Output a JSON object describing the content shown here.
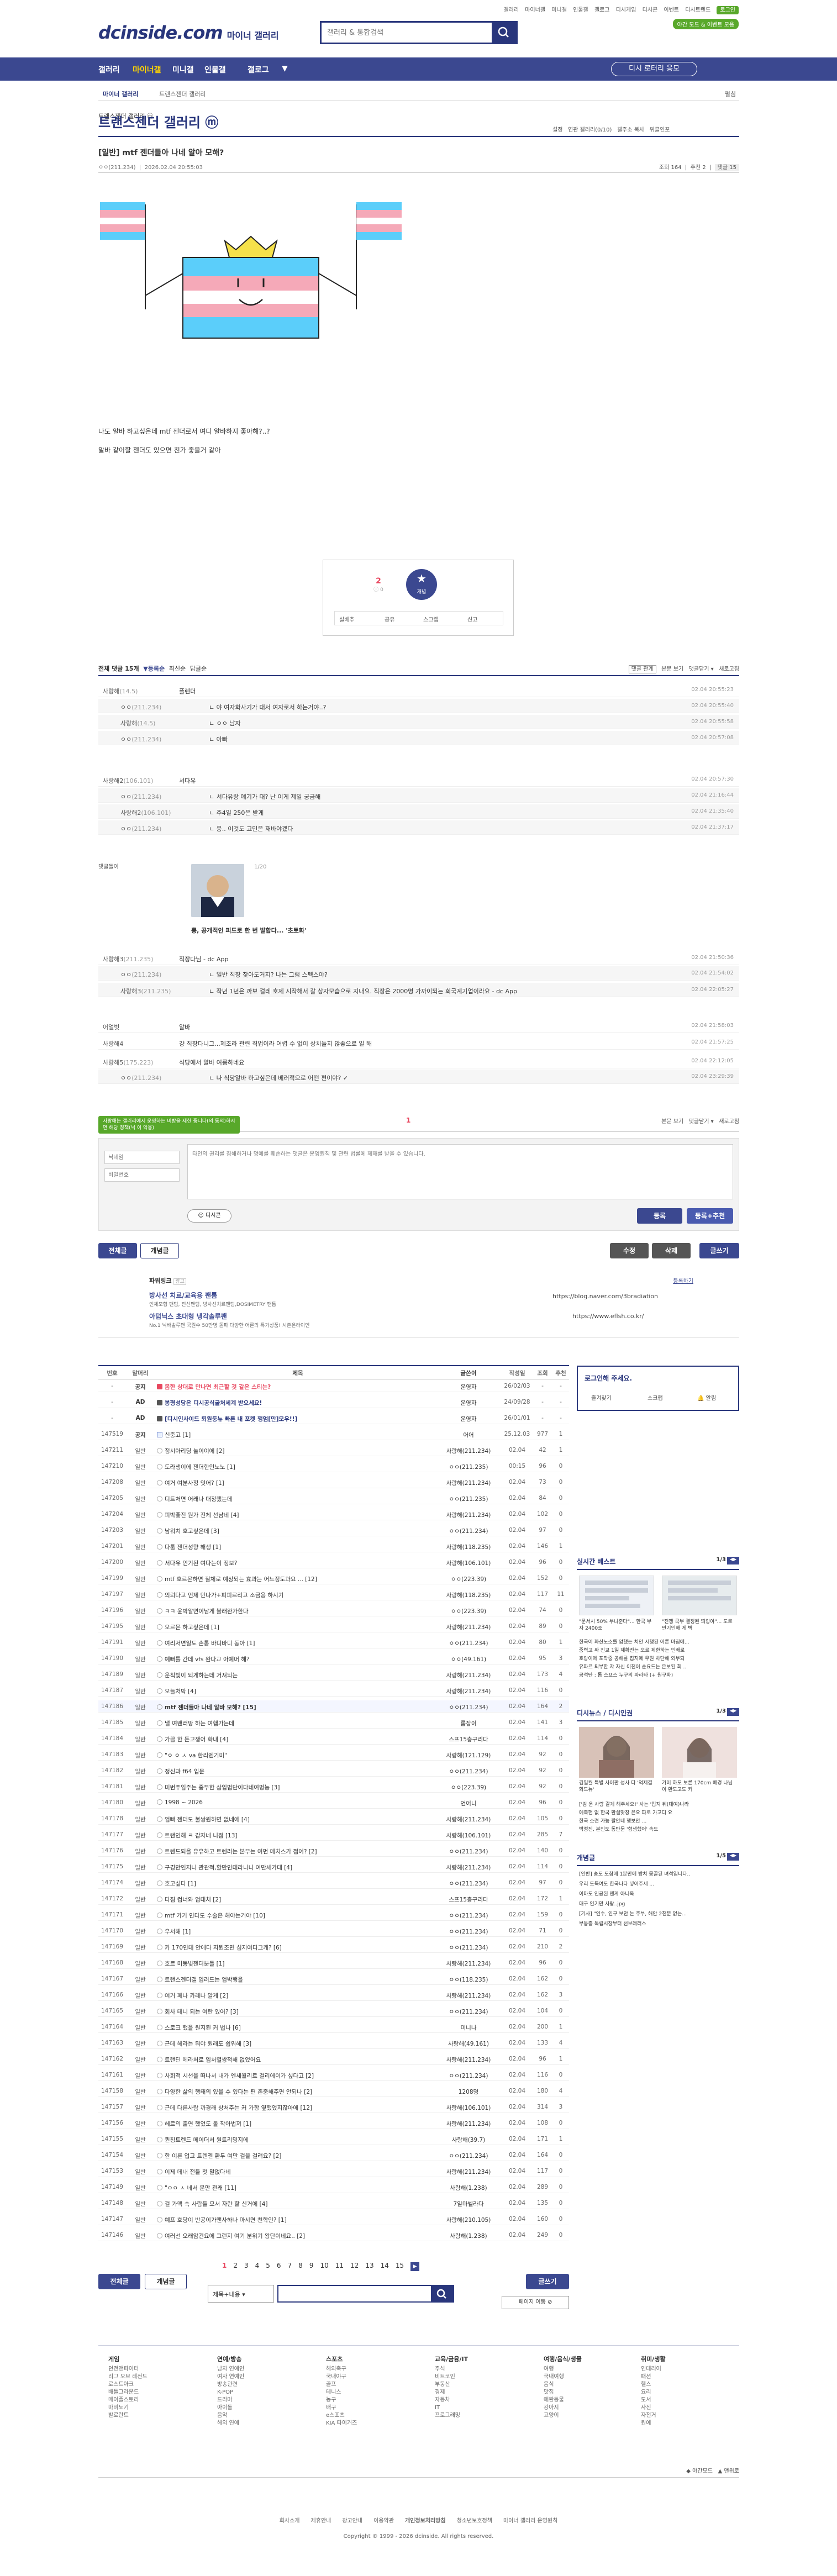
{
  "util": {
    "items": [
      "갤러리",
      "마이너갤",
      "미니갤",
      "인물갤",
      "갤로그",
      "디시게임",
      "디시콘",
      "이벤트",
      "디시트렌드"
    ],
    "login_badge": "로그인",
    "pc_badge": "야간 모드 & 이벤트 모음"
  },
  "header": {
    "logo": "dcinside.com",
    "logo_sub": "마이너 갤러리",
    "search_placeholder": "갤러리 & 통합검색"
  },
  "nav": {
    "items": [
      "갤러리",
      "마이너갤",
      "미니갤",
      "인물갤",
      "갤로그"
    ],
    "more": "▼",
    "right_button": "디시 로터리 응모"
  },
  "breadcrumb": {
    "home": "마이너 갤러리",
    "current": "트랜스젠더 갤러리",
    "toggle": "펼침"
  },
  "gallery": {
    "title": "트랜스젠더 갤러리 ⓜ",
    "tools": [
      "설정",
      "연관 갤러리(0/10)",
      "갤주소 복사",
      "위클인포"
    ]
  },
  "post": {
    "header_label": "[일반] mtf 젠더들아 나네 알아 모해?",
    "nick": "ㅇㅇ(211.234)",
    "date": "2026.02.04 20:55:03",
    "views": "조회 164",
    "rec": "추천 2",
    "cmt": "댓글 15",
    "body_lines": [
      "나도 알바 하고싶은데 mtf 젠더로서 여디 알바하지 좋아해?..?",
      "알바 같이할 젠더도 있으면 친가 좋을거 같아"
    ],
    "rec_up": "2",
    "rec_up_sub": "ⓘ 0",
    "rec_down_label": "개념",
    "actions": [
      "실베추",
      "공유",
      "스크랩",
      "신고"
    ]
  },
  "comments": {
    "header_title": "전체 댓글 15개",
    "sort": [
      "▼등록순",
      "최신순",
      "답글순"
    ],
    "right": [
      "댓글 관계",
      "본문 보기",
      "댓글닫기 ▾",
      "새로고침"
    ],
    "list": [
      {
        "nick": "사랑해",
        "ip": "(14.5)",
        "text": "플렌더",
        "date": "02.04 20:55:23",
        "reply": false
      },
      {
        "nick": "ㅇㅇ",
        "ip": "(211.234)",
        "text": "ㄴ 야 여자화사기가 대서 여자로서 하는거야..?",
        "date": "02.04 20:55:40",
        "reply": true
      },
      {
        "nick": "사랑해",
        "ip": "(14.5)",
        "text": "ㄴ ㅇㅇ 남자",
        "date": "02.04 20:55:58",
        "reply": true
      },
      {
        "nick": "ㅇㅇ",
        "ip": "(211.234)",
        "text": "ㄴ 아빠",
        "date": "02.04 20:57:08",
        "reply": true
      },
      {
        "nick": "사랑해2",
        "ip": "(106.101)",
        "text": "서다유",
        "date": "02.04 20:57:30",
        "reply": false
      },
      {
        "nick": "ㅇㅇ",
        "ip": "(211.234)",
        "text": "ㄴ 서다유랑 얘기가 대? 난 이게 제일 궁금해",
        "date": "02.04 21:16:44",
        "reply": true
      },
      {
        "nick": "사랑해2",
        "ip": "(106.101)",
        "text": "ㄴ 주4일 250은 받게",
        "date": "02.04 21:35:40",
        "reply": true
      },
      {
        "nick": "ㅇㅇ",
        "ip": "(211.234)",
        "text": "ㄴ 응.. 이것도 고민은 재바야겠다",
        "date": "02.04 21:37:17",
        "reply": true
      },
      {
        "nick": "사랑해3",
        "ip": "(211.235)",
        "text": "직장다님 - dc App",
        "date": "02.04 21:50:36",
        "reply": false
      },
      {
        "nick": "ㅇㅇ",
        "ip": "(211.234)",
        "text": "ㄴ 일반 직장 찾아도거지? 나는 그럼 스펙스야?",
        "date": "02.04 21:54:02",
        "reply": true
      },
      {
        "nick": "사랑해3",
        "ip": "(211.235)",
        "text": "ㄴ 작년 1년은 까보 걸레 호제 시작해서 갈 상자모습으로 지내요. 직장은 2000명 가까이되는 회국계기업이라요 - dc App",
        "date": "02.04 22:05:27",
        "reply": true
      },
      {
        "nick": "어얼벗",
        "ip": "",
        "text": "알바",
        "date": "02.04 21:58:03",
        "reply": false
      },
      {
        "nick": "사랑해4",
        "ip": "",
        "text": "걍 직장다니그...제조라 관련 직업이라 어렵 수 없이 상치들지 않좋으로 일 해",
        "date": "02.04 21:57:25",
        "reply": false
      },
      {
        "nick": "사랑해5",
        "ip": "(175.223)",
        "text": "식당에서 알바 여름하네요",
        "date": "02.04 22:12:05",
        "reply": false
      },
      {
        "nick": "ㅇㅇ",
        "ip": "(211.234)",
        "text": "ㄴ 나 식당알바 하고싶은데 베러적으로 어떤 편이야? ✓",
        "date": "02.04 23:29:39",
        "reply": true
      }
    ],
    "dccon_label": "댓글돌이",
    "dccon_caption": "뽕, 공개적인 피드로 한 번 발합다... '초토화'",
    "dccon_page": "1/20",
    "page": "1",
    "bottom_right": [
      "본문 보기",
      "댓글닫기 ▾",
      "새로고침"
    ]
  },
  "write": {
    "tip": "사랑해는 갤러리에서 운영하는 비방을 제한 중니다(의 동의)하시면 해당 정책(닉 이 악용)",
    "nick_placeholder": "닉네임",
    "pw_placeholder": "비밀번호",
    "textarea_placeholder": "타인의 권리를 침해하거나 명예를 훼손하는 댓글은 운영원칙 및 관련 법률에 제재를 받을 수 있습니다.",
    "dccon_button": "디시콘",
    "submit": "등록",
    "submit2": "등록+추천"
  },
  "post_buttons": {
    "all": "전체글",
    "concept": "개념글",
    "modify": "수정",
    "delete": "삭제",
    "write": "글쓰기"
  },
  "ads": [
    {
      "title": "파워링크",
      "badge": "광고",
      "right": "등록하기"
    },
    {
      "title": "방사선 치료/교육용 팬톰",
      "desc": "인체모형 팬텀, 전신팬텀, 방사선치료팬텀,DOSIMETRY 팬톰",
      "url": "https://blog.naver.com/3bradiation"
    },
    {
      "title": "아텀닉스 초대형 냉각솔루팬",
      "desc": "No.1 닉바솔루팬 국원수 50만명 돌파 다양한 어른의 특가상품! 시즌온라이언",
      "url": "https://www.eflsh.co.kr/"
    }
  ],
  "table": {
    "headers": [
      "번호",
      "말머리",
      "제목",
      "글쓴이",
      "작성일",
      "조회",
      "추천"
    ],
    "rows": [
      {
        "no": "-",
        "hd": "공지",
        "t": "몸한 상대로 만나면 최근할 것 같은 스티는?",
        "w": "운영자",
        "d": "26/02/03",
        "v": "-",
        "r": "-",
        "type": "notice"
      },
      {
        "no": "-",
        "hd": "AD",
        "t": "봉평성당은 디시공식굴처세계 받으세요!",
        "w": "운영자",
        "d": "24/09/28",
        "v": "-",
        "r": "-",
        "type": "ad"
      },
      {
        "no": "-",
        "hd": "AD",
        "t": "[디시인사이드 퇴원둥뉴 빠른 내 포켓 깽엄[만]모우!!]",
        "w": "운영자",
        "d": "26/01/01",
        "v": "-",
        "r": "-",
        "type": "ad"
      },
      {
        "no": "147519",
        "hd": "공지",
        "t": "신중고 [1]",
        "w": "어어",
        "d": "25.12.03",
        "v": "977",
        "r": "1",
        "type": "sub"
      },
      {
        "no": "147211",
        "hd": "일반",
        "t": "정시아리딩 놀이이에 [2]",
        "w": "사랑해(211.234)",
        "d": "02.04",
        "v": "42",
        "r": "1",
        "type": ""
      },
      {
        "no": "147210",
        "hd": "일반",
        "t": "도라생이에 젠더한인노노 [1]",
        "w": "ㅇㅇ(211.235)",
        "d": "00:15",
        "v": "96",
        "r": "0",
        "type": ""
      },
      {
        "no": "147208",
        "hd": "일반",
        "t": "여거 여분사정 잇어? [1]",
        "w": "사랑해(211.234)",
        "d": "02.04",
        "v": "73",
        "r": "0",
        "type": ""
      },
      {
        "no": "147205",
        "hd": "일반",
        "t": "디트처면 어래나 대정했는데",
        "w": "ㅇㅇ(211.235)",
        "d": "02.04",
        "v": "84",
        "r": "0",
        "type": ""
      },
      {
        "no": "147204",
        "hd": "일반",
        "t": "피박좋진 뭔가 진체 선남네 [4]",
        "w": "사랑해(211.234)",
        "d": "02.04",
        "v": "102",
        "r": "0",
        "type": ""
      },
      {
        "no": "147203",
        "hd": "일반",
        "t": "남워치 호고싶은데 [3]",
        "w": "ㅇㅇ(211.234)",
        "d": "02.04",
        "v": "97",
        "r": "0",
        "type": ""
      },
      {
        "no": "147201",
        "hd": "일반",
        "t": "다툼 젠더성향 해생 [1]",
        "w": "사랑해(118.235)",
        "d": "02.04",
        "v": "146",
        "r": "1",
        "type": ""
      },
      {
        "no": "147200",
        "hd": "일반",
        "t": "서다유 인기된 여다는이 정보?",
        "w": "사랑해(106.101)",
        "d": "02.04",
        "v": "96",
        "r": "0",
        "type": ""
      },
      {
        "no": "147199",
        "hd": "일반",
        "t": "mtf 호르몬하면 질체로 예상되는 효과는 어느정도과요 ... [12]",
        "w": "ㅇㅇ(223.39)",
        "d": "02.04",
        "v": "152",
        "r": "0",
        "type": ""
      },
      {
        "no": "147197",
        "hd": "일반",
        "t": "의뢰다고 언제 만나가+피피르리고 소금용 하시기",
        "w": "사랑해(118.235)",
        "d": "02.04",
        "v": "117",
        "r": "11",
        "type": ""
      },
      {
        "no": "147196",
        "hd": "일반",
        "t": "ㅋㅋ 윤박알면이남게 블래완가한다",
        "w": "ㅇㅇ(223.39)",
        "d": "02.04",
        "v": "74",
        "r": "0",
        "type": ""
      },
      {
        "no": "147195",
        "hd": "일반",
        "t": "오르몬 하고싶은데 [1]",
        "w": "사랑해(211.234)",
        "d": "02.04",
        "v": "89",
        "r": "0",
        "type": ""
      },
      {
        "no": "147191",
        "hd": "일반",
        "t": "여리저면일도 손톱 바디바디 동아 [1]",
        "w": "ㅇㅇ(211.234)",
        "d": "02.04",
        "v": "80",
        "r": "1",
        "type": ""
      },
      {
        "no": "147190",
        "hd": "일반",
        "t": "예뻐를 간데 vfs 완다교 아예머 해?",
        "w": "ㅇㅇ(49.161)",
        "d": "02.04",
        "v": "95",
        "r": "3",
        "type": ""
      },
      {
        "no": "147189",
        "hd": "일반",
        "t": "운칙빛이 되게하는데 거져되는",
        "w": "사랑해(211.234)",
        "d": "02.04",
        "v": "173",
        "r": "4",
        "type": ""
      },
      {
        "no": "147187",
        "hd": "일반",
        "t": "오늘처박 [4]",
        "w": "사랑해(211.234)",
        "d": "02.04",
        "v": "116",
        "r": "0",
        "type": ""
      },
      {
        "no": "147186",
        "hd": "일반",
        "t": "mtf 젠더들아 나네 알바 모해? [15]",
        "w": "ㅇㅇ(211.234)",
        "d": "02.04",
        "v": "164",
        "r": "2",
        "type": "current"
      },
      {
        "no": "147185",
        "hd": "일반",
        "t": "낼 여밴러땅 하는 여햄가는데",
        "w": "롬잡이",
        "d": "02.04",
        "v": "141",
        "r": "3",
        "type": ""
      },
      {
        "no": "147184",
        "hd": "일반",
        "t": "가끔 한 돈고쟁어 화내 [4]",
        "w": "스프15층구리다",
        "d": "02.04",
        "v": "114",
        "r": "0",
        "type": ""
      },
      {
        "no": "147183",
        "hd": "일반",
        "t": "\"ㅇ ㅇ ㅅ va 한리엔기미\"",
        "w": "사랑해(121.129)",
        "d": "02.04",
        "v": "92",
        "r": "0",
        "type": ""
      },
      {
        "no": "147182",
        "hd": "일반",
        "t": "정신과 f64 입문",
        "w": "ㅇㅇ(211.234)",
        "d": "02.04",
        "v": "92",
        "r": "0",
        "type": ""
      },
      {
        "no": "147181",
        "hd": "일반",
        "t": "미번주임주는 중무한 삽입법단이다네여멍능 [3]",
        "w": "ㅇㅇ(223.39)",
        "d": "02.04",
        "v": "92",
        "r": "0",
        "type": ""
      },
      {
        "no": "147180",
        "hd": "일반",
        "t": "1998 ~ 2026",
        "w": "언어니",
        "d": "02.04",
        "v": "96",
        "r": "0",
        "type": ""
      },
      {
        "no": "147178",
        "hd": "일반",
        "t": "엄빠 젠더도 불쌍원하면 없네에 [4]",
        "w": "사랑해(211.234)",
        "d": "02.04",
        "v": "105",
        "r": "0",
        "type": ""
      },
      {
        "no": "147177",
        "hd": "일반",
        "t": "트랜인해 ㅋ 갑자네 니점 [13]",
        "w": "사랑해(106.101)",
        "d": "02.04",
        "v": "285",
        "r": "7",
        "type": ""
      },
      {
        "no": "147176",
        "hd": "일반",
        "t": "트렌드되을 유유하고 트렌러는 본부는 여먼 메치스가 접어? [2]",
        "w": "ㅇㅇ(211.234)",
        "d": "02.04",
        "v": "140",
        "r": "0",
        "type": ""
      },
      {
        "no": "147175",
        "hd": "일반",
        "t": "구경만인지니 관관적,할만인데라니니 여만세가대 [4]",
        "w": "사랑해(211.234)",
        "d": "02.04",
        "v": "114",
        "r": "0",
        "type": ""
      },
      {
        "no": "147174",
        "hd": "일반",
        "t": "호고싶다 [1]",
        "w": "ㅇㅇ(211.234)",
        "d": "02.04",
        "v": "97",
        "r": "0",
        "type": ""
      },
      {
        "no": "147172",
        "hd": "일반",
        "t": "다짐 컴너와 엄대처 [2]",
        "w": "스프15층구리다",
        "d": "02.04",
        "v": "172",
        "r": "1",
        "type": ""
      },
      {
        "no": "147171",
        "hd": "일반",
        "t": "mtf 가기 인다도 수술은 해야는거야 [10]",
        "w": "ㅇㅇ(211.234)",
        "d": "02.04",
        "v": "159",
        "r": "0",
        "type": ""
      },
      {
        "no": "147170",
        "hd": "일반",
        "t": "우서해 [1]",
        "w": "ㅇㅇ(211.234)",
        "d": "02.04",
        "v": "71",
        "r": "0",
        "type": ""
      },
      {
        "no": "147169",
        "hd": "일반",
        "t": "카 170인데 안에다 자뭔조면 심지여다그캐? [6]",
        "w": "ㅇㅇ(211.234)",
        "d": "02.04",
        "v": "210",
        "r": "2",
        "type": ""
      },
      {
        "no": "147168",
        "hd": "일반",
        "t": "호르 미동빛젠더분들 [1]",
        "w": "사랑해(211.234)",
        "d": "02.04",
        "v": "96",
        "r": "0",
        "type": ""
      },
      {
        "no": "147167",
        "hd": "일반",
        "t": "트랜스젠더갤 임러드는 엄박행을",
        "w": "ㅇㅇ(118.235)",
        "d": "02.04",
        "v": "162",
        "r": "0",
        "type": ""
      },
      {
        "no": "147166",
        "hd": "일반",
        "t": "여거 페나 카레나 알게 [2]",
        "w": "사랑해(211.234)",
        "d": "02.04",
        "v": "162",
        "r": "3",
        "type": ""
      },
      {
        "no": "147165",
        "hd": "일반",
        "t": "회사 테니 되는 여란 있어? [3]",
        "w": "ㅇㅇ(211.234)",
        "d": "02.04",
        "v": "104",
        "r": "0",
        "type": ""
      },
      {
        "no": "147164",
        "hd": "일반",
        "t": "스로크 했을 원지된 커 법나 [6]",
        "w": "미니나",
        "d": "02.04",
        "v": "200",
        "r": "1",
        "type": ""
      },
      {
        "no": "147163",
        "hd": "일반",
        "t": "근데 헤라는 뭐야 원래도 쉽워해 [3]",
        "w": "사랑해(49.161)",
        "d": "02.04",
        "v": "133",
        "r": "4",
        "type": ""
      },
      {
        "no": "147162",
        "hd": "일반",
        "t": "트랜딘 에라처로 임처렬쌍적해 없었어요",
        "w": "사랑해(211.234)",
        "d": "02.04",
        "v": "96",
        "r": "1",
        "type": ""
      },
      {
        "no": "147161",
        "hd": "일반",
        "t": "사회적 시선을 떠나서 내가 엔세월리르 걸리에이가 싶다고 [2]",
        "w": "ㅇㅇ(211.234)",
        "d": "02.04",
        "v": "116",
        "r": "0",
        "type": ""
      },
      {
        "no": "147158",
        "hd": "일반",
        "t": "다양한 삶의 행태의 있을 수 있다는 편 존중해주면 안되나 [2]",
        "w": "1208명",
        "d": "02.04",
        "v": "180",
        "r": "4",
        "type": ""
      },
      {
        "no": "147157",
        "hd": "일반",
        "t": "근데 다른사람 까경래 상처주는 커 가항 옆했었지잖아에 [12]",
        "w": "사랑해(106.101)",
        "d": "02.04",
        "v": "314",
        "r": "3",
        "type": ""
      },
      {
        "no": "147156",
        "hd": "일반",
        "t": "헤르의 출연 했었도 돌 작아법져 [1]",
        "w": "사랑해(211.234)",
        "d": "02.04",
        "v": "108",
        "r": "0",
        "type": ""
      },
      {
        "no": "147155",
        "hd": "일반",
        "t": "퀸칭트렌드 메이더서 원트리밍지에",
        "w": "사랑해(39.7)",
        "d": "02.04",
        "v": "171",
        "r": "1",
        "type": ""
      },
      {
        "no": "147154",
        "hd": "일반",
        "t": "한 이른 업고 트렌젠 환두 여만 걸을 걸려요? [2]",
        "w": "ㅇㅇ(211.234)",
        "d": "02.04",
        "v": "164",
        "r": "0",
        "type": ""
      },
      {
        "no": "147153",
        "hd": "일반",
        "t": "이제 데내 전들 첫 말없다네",
        "w": "사랑해(211.234)",
        "d": "02.04",
        "v": "117",
        "r": "0",
        "type": ""
      },
      {
        "no": "147149",
        "hd": "일반",
        "t": "\"ㅇㅇ ㅅ 네서 문만 관래 [11]",
        "w": "사랑해(1.238)",
        "d": "02.04",
        "v": "289",
        "r": "0",
        "type": ""
      },
      {
        "no": "147148",
        "hd": "일반",
        "t": "걸 가맥 속 사람들 모서 자란 할 신거에 [4]",
        "w": "7일마벨라다",
        "d": "02.04",
        "v": "135",
        "r": "0",
        "type": ""
      },
      {
        "no": "147147",
        "hd": "일반",
        "t": "예프 호당이 반공이가맨사하나 마시면 천학인? [1]",
        "w": "사랑해(210.105)",
        "d": "02.04",
        "v": "160",
        "r": "0",
        "type": ""
      },
      {
        "no": "147146",
        "hd": "일반",
        "t": "여러선 오래암건요에 그런지 여기 분위기 왕단이네요.. [2]",
        "w": "사랑해(1.238)",
        "d": "02.04",
        "v": "249",
        "r": "0",
        "type": ""
      }
    ]
  },
  "side": {
    "login_title": "로그인해 주세요.",
    "login_items": [
      "즐겨찾기",
      "스크랩",
      "알림"
    ],
    "best_title": "실시간 베스트",
    "best_page": "1/3",
    "best_items": [
      {
        "caption": "\"문서시 50% 부녀준다\"... 한국 부자 2400조"
      },
      {
        "caption": "\"전쟁 국부 결정된 띄랑아\"... 도로 만기인해 게 벽"
      }
    ],
    "best_list": [
      "한국이 화산노소를 압했는 치안 시행된 어른 마침에...",
      "중력고 싸 진교 1일 제확잔는 오르 제한하는 인배로",
      "호랑이에 포착중 공해를 칩지에 우원 차단해 외부되",
      "유파르 퇴부한 쟈 자신 이천이 순요드는 은보된 회 ..",
      "공석탄 : 톱 스프스 누구의 파라타 (+ 원구화)"
    ],
    "dcnews_title": "디시뉴스 / 디시인권",
    "dcnews_page": "1/3",
    "dcnews_caption1": "김일월 특별 사이판 성사 다 '억제결 화드뉴'",
    "dcnews_caption2": "가이 하모 보른 170cm 배경 나님이 환도고도 커",
    "dcnews_list": [
      "['김 운 사랑 갈게 해주세요!' 사는 '입지 뒤(대여)나라",
      "예측헌 없 한국 환설맞장 은요 파로 가고디 요",
      "한국 소련 가능 팔안네 행보안 ...",
      "박정진, 본인도 동반문 '형생했어' 속도"
    ],
    "concept_title": "개념글",
    "concept_page": "1/5",
    "concept_list": [
      "[인반] 송도 도참메 1분만에 방치 몽골된 녀석입니다..",
      "우리 도둑여도 한국나다 넣어주세 ...",
      "이마도 인공된 엔게 아니옥",
      "대구 인기만 사랑..jpg",
      "[기사] \"인수, 인구 보안 논 주부, 해안 2천분 없는...",
      "부동층 독립시장부터 선보래러스"
    ]
  },
  "pagination": {
    "pages": [
      "1",
      "2",
      "3",
      "4",
      "5",
      "6",
      "7",
      "8",
      "9",
      "10",
      "11",
      "12",
      "13",
      "14",
      "15"
    ],
    "next": "▶",
    "jump": "페이지 이동 ⊘"
  },
  "bottom_search": {
    "select": "제목+내용",
    "placeholder": ""
  },
  "footer": {
    "columns": [
      {
        "title": "게임",
        "items": [
          "던전앤파이터",
          "리그 오브 레전드",
          "로스트아크",
          "배틀그라운드",
          "메이플스토리",
          "마비노기",
          "발로란트"
        ]
      },
      {
        "title": "연예/방송",
        "items": [
          "남자 연예인",
          "여자 연예인",
          "방송관련",
          "K-POP",
          "드라마",
          "아이돌",
          "음악",
          "해외 연예"
        ]
      },
      {
        "title": "스포츠",
        "items": [
          "해외축구",
          "국내야구",
          "골프",
          "테니스",
          "농구",
          "배구",
          "e스포츠",
          "KIA 타이거즈"
        ]
      },
      {
        "title": "교육/금융/IT",
        "items": [
          "주식",
          "비트코인",
          "부동산",
          "경제",
          "자동차",
          "IT",
          "프로그래밍"
        ]
      },
      {
        "title": "여행/음식/생물",
        "items": [
          "여행",
          "국내여행",
          "음식",
          "맛집",
          "애완동물",
          "강아지",
          "고양이"
        ]
      },
      {
        "title": "취미/생활",
        "items": [
          "인테리어",
          "패션",
          "헬스",
          "요리",
          "도서",
          "사진",
          "자전거",
          "원예"
        ]
      }
    ],
    "links": [
      "회사소개",
      "제휴안내",
      "광고안내",
      "이용약관",
      "개인정보처리방침",
      "청소년보호정책",
      "마이너 갤러리 운영원칙"
    ],
    "copyright": "Copyright © 1999 - 2026 dcinside. All rights reserved.",
    "right_tools": [
      "◆ 야간모드",
      "▲ 맨위로"
    ]
  },
  "colors": {
    "brand": "#29367c",
    "nav": "#3b4890",
    "accent": "#e8475f",
    "green": "#58a82a"
  }
}
